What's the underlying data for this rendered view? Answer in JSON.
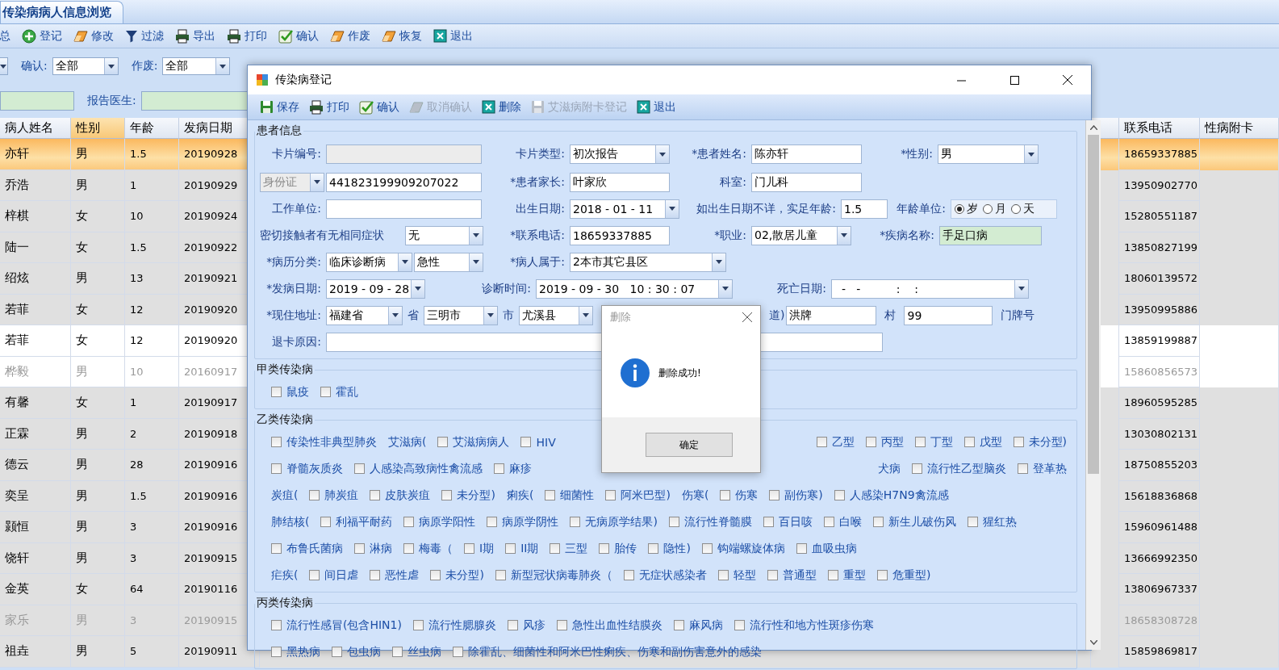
{
  "app": {
    "tab": {
      "label": "传染病病人信息浏览"
    },
    "toolbar": [
      {
        "label": "总"
      },
      {
        "label": "登记"
      },
      {
        "label": "修改"
      },
      {
        "label": "过滤"
      },
      {
        "label": "导出"
      },
      {
        "label": "打印"
      },
      {
        "label": "确认"
      },
      {
        "label": "作废"
      },
      {
        "label": "恢复"
      },
      {
        "label": "退出"
      }
    ],
    "filters": {
      "confirm": {
        "label": "确认:",
        "value": "全部"
      },
      "void": {
        "label": "作废:",
        "value": "全部"
      },
      "doctor": {
        "label": "报告医生:"
      }
    },
    "table": {
      "columns": [
        {
          "label": "病人姓名",
          "sorted": false
        },
        {
          "label": "性别",
          "sorted": true
        },
        {
          "label": "年龄",
          "sorted": false
        },
        {
          "label": "发病日期",
          "sorted": false
        }
      ],
      "right_columns": [
        {
          "label": "联系电话"
        },
        {
          "label": "性病附卡"
        }
      ],
      "rows": [
        {
          "cells": [
            "亦轩",
            "男",
            "1.5",
            "20190928"
          ],
          "phone": "18659337885",
          "selected": true,
          "kind": "shaded",
          "voided": false
        },
        {
          "cells": [
            "乔浩",
            "男",
            "1",
            "20190929"
          ],
          "phone": "13950902770",
          "selected": false,
          "kind": "shaded",
          "voided": false
        },
        {
          "cells": [
            "梓棋",
            "女",
            "10",
            "20190924"
          ],
          "phone": "15280551187",
          "selected": false,
          "kind": "shaded",
          "voided": false
        },
        {
          "cells": [
            "陆一",
            "女",
            "1.5",
            "20190922"
          ],
          "phone": "13850827199",
          "selected": false,
          "kind": "shaded",
          "voided": false
        },
        {
          "cells": [
            "绍炫",
            "男",
            "13",
            "20190921"
          ],
          "phone": "18060139572",
          "selected": false,
          "kind": "shaded",
          "voided": false
        },
        {
          "cells": [
            "若菲",
            "女",
            "12",
            "20190920"
          ],
          "phone": "13950995886",
          "selected": false,
          "kind": "shaded",
          "voided": false
        },
        {
          "cells": [
            "若菲",
            "女",
            "12",
            "20190920"
          ],
          "phone": "13859199887",
          "selected": false,
          "kind": "plain",
          "voided": false
        },
        {
          "cells": [
            "桦毅",
            "男",
            "10",
            "20160917"
          ],
          "phone": "15860856573",
          "selected": false,
          "kind": "plain",
          "voided": true
        },
        {
          "cells": [
            "有馨",
            "女",
            "1",
            "20190917"
          ],
          "phone": "18960595285",
          "selected": false,
          "kind": "shaded",
          "voided": false
        },
        {
          "cells": [
            "正霖",
            "男",
            "2",
            "20190918"
          ],
          "phone": "13030802131",
          "selected": false,
          "kind": "shaded",
          "voided": false
        },
        {
          "cells": [
            "德云",
            "男",
            "28",
            "20190916"
          ],
          "phone": "18750855203",
          "selected": false,
          "kind": "shaded",
          "voided": false
        },
        {
          "cells": [
            "奕呈",
            "男",
            "1.5",
            "20190916"
          ],
          "phone": "15618836868",
          "selected": false,
          "kind": "shaded",
          "voided": false
        },
        {
          "cells": [
            "颢恒",
            "男",
            "3",
            "20190916"
          ],
          "phone": "15960961488",
          "selected": false,
          "kind": "shaded",
          "voided": false
        },
        {
          "cells": [
            "饶轩",
            "男",
            "3",
            "20190915"
          ],
          "phone": "13666992350",
          "selected": false,
          "kind": "shaded",
          "voided": false
        },
        {
          "cells": [
            "金英",
            "女",
            "64",
            "20190116"
          ],
          "phone": "13806967337",
          "selected": false,
          "kind": "shaded",
          "voided": false
        },
        {
          "cells": [
            "家乐",
            "男",
            "3",
            "20190915"
          ],
          "phone": "18658308728",
          "selected": false,
          "kind": "shaded",
          "voided": true
        },
        {
          "cells": [
            "祖垚",
            "男",
            "5",
            "20190911"
          ],
          "phone": "15859869817",
          "selected": false,
          "kind": "shaded",
          "voided": false
        }
      ]
    }
  },
  "dialog": {
    "title": "传染病登记",
    "toolbar": [
      {
        "label": "保存",
        "disabled": false
      },
      {
        "label": "打印",
        "disabled": false
      },
      {
        "label": "确认",
        "disabled": false
      },
      {
        "label": "取消确认",
        "disabled": true
      },
      {
        "label": "删除",
        "disabled": false
      },
      {
        "label": "艾滋病附卡登记",
        "disabled": true
      },
      {
        "label": "退出",
        "disabled": false
      }
    ],
    "patient_info": {
      "title": "患者信息",
      "rows": [
        [
          {
            "kind": "text",
            "label": "卡片编号:",
            "disabled": true,
            "highlighted": false
          },
          {
            "kind": "select",
            "label": "卡片类型:",
            "value": "初次报告"
          },
          {
            "kind": "text",
            "label": "*患者姓名:",
            "value": "陈亦轩",
            "disabled": false,
            "highlighted": false
          },
          {
            "kind": "select",
            "label": "*性别:",
            "value": "男"
          }
        ],
        [
          {
            "kind": "id",
            "select": "身份证",
            "value": "441823199909207022"
          },
          {
            "kind": "text",
            "label": "*患者家长:",
            "value": "叶家欣",
            "disabled": false,
            "highlighted": false
          },
          {
            "kind": "text",
            "label": "科室:",
            "value": "门儿科",
            "disabled": false,
            "highlighted": false
          }
        ],
        [
          {
            "kind": "text",
            "label": "工作单位:",
            "disabled": false,
            "highlighted": false
          },
          {
            "kind": "select",
            "label": "出生日期:",
            "value": "2018 - 01 - 11"
          },
          {
            "kind": "text",
            "label": "如出生日期不详，实足年龄:",
            "value": "1.5",
            "disabled": false,
            "highlighted": false
          },
          {
            "kind": "radio",
            "label": "年龄单位:",
            "options": [
              {
                "label": "岁",
                "selected": true
              },
              {
                "label": "月",
                "selected": false
              },
              {
                "label": "天",
                "selected": false
              }
            ]
          }
        ],
        [
          {
            "kind": "select",
            "label": "密切接触者有无相同症状",
            "value": "无"
          },
          {
            "kind": "text",
            "label": "*联系电话:",
            "value": "18659337885",
            "disabled": false,
            "highlighted": false
          },
          {
            "kind": "select",
            "label": "*职业:",
            "value": "02,散居儿童"
          },
          {
            "kind": "text",
            "label": "*疾病名称:",
            "value": "手足口病",
            "disabled": false,
            "highlighted": true
          }
        ],
        [
          {
            "kind": "pair",
            "label": "*病历分类:",
            "values": [
              "临床诊断病",
              "急性"
            ]
          },
          {
            "kind": "select",
            "label": "*病人属于:",
            "value": "2本市其它县区"
          }
        ],
        [
          {
            "kind": "select",
            "label": "*发病日期:",
            "value": "2019 - 09 - 28"
          },
          {
            "kind": "select",
            "label": "诊断时间:",
            "value": "2019 - 09 - 30   10 : 30 : 07"
          },
          {
            "kind": "select",
            "label": "死亡日期:",
            "value": "  -   -          :    :"
          }
        ],
        [
          {
            "kind": "address",
            "label": "*现住地址:",
            "parts": [
              {
                "kind": "select",
                "value": "福建省"
              },
              {
                "kind": "unit",
                "text": "省"
              },
              {
                "kind": "select",
                "value": "三明市"
              },
              {
                "kind": "unit",
                "text": "市"
              },
              {
                "kind": "select",
                "value": "尤溪县"
              },
              {
                "kind": "unit",
                "text": "道)"
              },
              {
                "kind": "field",
                "value": "洪牌"
              },
              {
                "kind": "unit",
                "text": "村"
              },
              {
                "kind": "field",
                "value": "99"
              },
              {
                "kind": "unit",
                "text": "门牌号"
              }
            ]
          }
        ],
        [
          {
            "kind": "text",
            "label": "退卡原因:",
            "disabled": false,
            "highlighted": false
          }
        ]
      ]
    },
    "groups": [
      {
        "title": "甲类传染病",
        "lines": [
          {
            "segments": [
              [
                {
                  "kind": "check",
                  "label": "鼠疫",
                  "checked": false
                },
                {
                  "kind": "check",
                  "label": "霍乱",
                  "checked": false
                }
              ]
            ]
          }
        ]
      },
      {
        "title": "乙类传染病",
        "lines": [
          {
            "segments": [
              [
                {
                  "kind": "check",
                  "label": "传染性非典型肺炎",
                  "checked": false
                },
                {
                  "kind": "text",
                  "label": "艾滋病("
                },
                {
                  "kind": "check",
                  "label": "艾滋病病人",
                  "checked": false
                },
                {
                  "kind": "check",
                  "label": "HIV",
                  "checked": false
                }
              ],
              [
                {
                  "kind": "check",
                  "label": "乙型",
                  "checked": false
                },
                {
                  "kind": "check",
                  "label": "丙型",
                  "checked": false
                },
                {
                  "kind": "check",
                  "label": "丁型",
                  "checked": false
                },
                {
                  "kind": "check",
                  "label": "戊型",
                  "checked": false
                },
                {
                  "kind": "check",
                  "label": "未分型)",
                  "checked": false
                }
              ]
            ]
          },
          {
            "segments": [
              [
                {
                  "kind": "check",
                  "label": "脊髓灰质炎",
                  "checked": false
                },
                {
                  "kind": "check",
                  "label": "人感染高致病性禽流感",
                  "checked": false
                },
                {
                  "kind": "check",
                  "label": "麻疹",
                  "checked": false
                }
              ],
              [
                {
                  "kind": "text",
                  "label": "犬病"
                },
                {
                  "kind": "check",
                  "label": "流行性乙型脑炎",
                  "checked": false
                },
                {
                  "kind": "check",
                  "label": "登革热",
                  "checked": false
                }
              ]
            ]
          },
          {
            "segments": [
              [
                {
                  "kind": "text",
                  "label": "炭疽("
                },
                {
                  "kind": "check",
                  "label": "肺炭疽",
                  "checked": false
                },
                {
                  "kind": "check",
                  "label": "皮肤炭疽",
                  "checked": false
                },
                {
                  "kind": "check",
                  "label": "未分型)",
                  "checked": false
                },
                {
                  "kind": "text",
                  "label": "痢疾("
                },
                {
                  "kind": "check",
                  "label": "细菌性",
                  "checked": false
                },
                {
                  "kind": "check",
                  "label": "阿米巴型)",
                  "checked": false
                },
                {
                  "kind": "text",
                  "label": "伤寒("
                },
                {
                  "kind": "check",
                  "label": "伤寒",
                  "checked": false
                },
                {
                  "kind": "check",
                  "label": "副伤寒)",
                  "checked": false
                },
                {
                  "kind": "check",
                  "label": "人感染H7N9禽流感",
                  "checked": false
                }
              ]
            ]
          },
          {
            "segments": [
              [
                {
                  "kind": "text",
                  "label": "肺结核("
                },
                {
                  "kind": "check",
                  "label": "利福平耐药",
                  "checked": false
                },
                {
                  "kind": "check",
                  "label": "病原学阳性",
                  "checked": false
                },
                {
                  "kind": "check",
                  "label": "病原学阴性",
                  "checked": false
                },
                {
                  "kind": "check",
                  "label": "无病原学结果)",
                  "checked": false
                },
                {
                  "kind": "check",
                  "label": "流行性脊髓膜",
                  "checked": false
                },
                {
                  "kind": "check",
                  "label": "百日咳",
                  "checked": false
                },
                {
                  "kind": "check",
                  "label": "白喉",
                  "checked": false
                },
                {
                  "kind": "check",
                  "label": "新生儿破伤风",
                  "checked": false
                },
                {
                  "kind": "check",
                  "label": "猩红热",
                  "checked": false
                }
              ]
            ]
          },
          {
            "segments": [
              [
                {
                  "kind": "check",
                  "label": "布鲁氏菌病",
                  "checked": false
                },
                {
                  "kind": "check",
                  "label": "淋病",
                  "checked": false
                },
                {
                  "kind": "check",
                  "label": "梅毒（",
                  "checked": false
                },
                {
                  "kind": "check",
                  "label": "I期",
                  "checked": false
                },
                {
                  "kind": "check",
                  "label": "II期",
                  "checked": false
                },
                {
                  "kind": "check",
                  "label": "三型",
                  "checked": false
                },
                {
                  "kind": "check",
                  "label": "胎传",
                  "checked": false
                },
                {
                  "kind": "check",
                  "label": "隐性)",
                  "checked": false
                },
                {
                  "kind": "check",
                  "label": "钩端螺旋体病",
                  "checked": false
                },
                {
                  "kind": "check",
                  "label": "血吸虫病",
                  "checked": false
                }
              ]
            ]
          },
          {
            "segments": [
              [
                {
                  "kind": "text",
                  "label": "疟疾("
                },
                {
                  "kind": "check",
                  "label": "间日虐",
                  "checked": false
                },
                {
                  "kind": "check",
                  "label": "恶性虐",
                  "checked": false
                },
                {
                  "kind": "check",
                  "label": "未分型)",
                  "checked": false
                },
                {
                  "kind": "check",
                  "label": "新型冠状病毒肺炎（",
                  "checked": false
                },
                {
                  "kind": "check",
                  "label": "无症状感染者",
                  "checked": false
                },
                {
                  "kind": "check",
                  "label": "轻型",
                  "checked": false
                },
                {
                  "kind": "check",
                  "label": "普通型",
                  "checked": false
                },
                {
                  "kind": "check",
                  "label": "重型",
                  "checked": false
                },
                {
                  "kind": "check",
                  "label": "危重型)",
                  "checked": false
                }
              ]
            ]
          }
        ]
      },
      {
        "title": "丙类传染病",
        "lines": [
          {
            "segments": [
              [
                {
                  "kind": "check",
                  "label": "流行性感冒(包含HIN1)",
                  "checked": false
                },
                {
                  "kind": "check",
                  "label": "流行性腮腺炎",
                  "checked": false
                },
                {
                  "kind": "check",
                  "label": "风疹",
                  "checked": false
                },
                {
                  "kind": "check",
                  "label": "急性出血性结膜炎",
                  "checked": false
                },
                {
                  "kind": "check",
                  "label": "麻风病",
                  "checked": false
                },
                {
                  "kind": "check",
                  "label": "流行性和地方性斑疹伤寒",
                  "checked": false
                }
              ]
            ]
          },
          {
            "segments": [
              [
                {
                  "kind": "check",
                  "label": "黑热病",
                  "checked": false
                },
                {
                  "kind": "check",
                  "label": "包虫病",
                  "checked": false
                },
                {
                  "kind": "check",
                  "label": "丝虫病",
                  "checked": false
                },
                {
                  "kind": "check",
                  "label": "除霍乱、细菌性和阿米巴性痢疾、伤寒和副伤害意外的感染",
                  "checked": false
                }
              ]
            ]
          }
        ]
      }
    ]
  },
  "message_box": {
    "title": "删除",
    "message": "删除成功!",
    "button": "确定"
  }
}
